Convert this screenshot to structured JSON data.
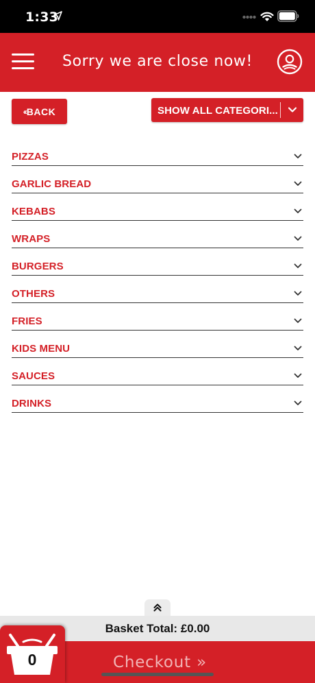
{
  "status_bar": {
    "time": "1:33"
  },
  "header": {
    "title": "Sorry we are close now!"
  },
  "toolbar": {
    "back_label": "BACK",
    "category_select_value": "SHOW ALL CATEGORI..."
  },
  "categories": [
    {
      "label": "PIZZAS"
    },
    {
      "label": "GARLIC BREAD"
    },
    {
      "label": "KEBABS"
    },
    {
      "label": "WRAPS"
    },
    {
      "label": "BURGERS"
    },
    {
      "label": "OTHERS"
    },
    {
      "label": "FRIES"
    },
    {
      "label": "KIDS MENU"
    },
    {
      "label": "SAUCES"
    },
    {
      "label": "DRINKS"
    }
  ],
  "footer": {
    "basket_total": "Basket Total: £0.00",
    "basket_count": "0",
    "checkout_label": "Checkout »"
  },
  "colors": {
    "brand_red": "#d42027",
    "checkout_text": "#f2b4b6",
    "bar_gray": "#e8e8e8"
  },
  "icons": {
    "menu": "hamburger-icon",
    "profile": "user-circle-icon",
    "category_toggle": "chevron-down-icon",
    "scroll_top": "double-chevron-up-icon",
    "basket": "basket-icon"
  }
}
